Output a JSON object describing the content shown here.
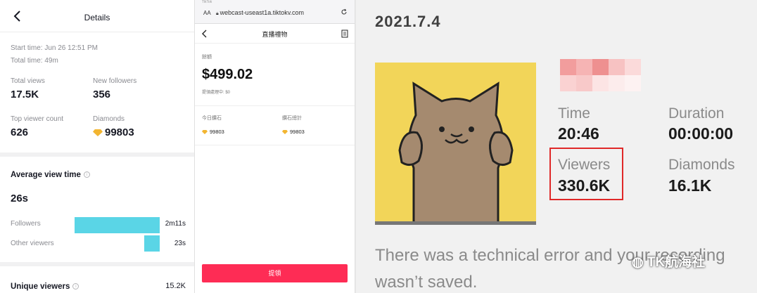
{
  "details": {
    "title": "Details",
    "start_time": "Start time: Jun 26 12:51 PM",
    "total_time": "Total time: 49m",
    "stats": [
      {
        "label": "Total views",
        "value": "17.5K"
      },
      {
        "label": "New followers",
        "value": "356"
      },
      {
        "label": "Top viewer count",
        "value": "626"
      },
      {
        "label": "Diamonds",
        "value": "99803"
      }
    ],
    "avg_view": {
      "title": "Average view time",
      "value": "26s"
    },
    "bars": [
      {
        "label": "Followers",
        "value": "2m11s",
        "fraction": 1.0
      },
      {
        "label": "Other viewers",
        "value": "23s",
        "fraction": 0.18
      }
    ],
    "unique": {
      "label": "Unique viewers",
      "value": "15.2K"
    }
  },
  "web": {
    "tab_hint": "TikTok",
    "aa": "AA",
    "url": "webcast-useast1a.tiktokv.com",
    "page_title": "直播禮物",
    "balance_label": "餘額",
    "balance": "$499.02",
    "pending": "提領處理中: $0",
    "today_label": "今日鑽石",
    "today_value": "99803",
    "total_label": "鑽石總計",
    "total_value": "99803",
    "button": "提領"
  },
  "recording": {
    "date": "2021.7.4",
    "time_label": "Time",
    "time_value": "20:46",
    "duration_label": "Duration",
    "duration_value": "00:00:00",
    "viewers_label": "Viewers",
    "viewers_value": "330.6K",
    "diamonds_label": "Diamonds",
    "diamonds_value": "16.1K",
    "error_line1": "There was a technical error and your recording",
    "error_line2": "wasn’t saved.",
    "watermark": "TK航海社"
  },
  "colors": {
    "accent_bar": "#5ad5e6",
    "button": "#fe2c55",
    "highlight": "#e02828",
    "cover": "#f2d559"
  }
}
